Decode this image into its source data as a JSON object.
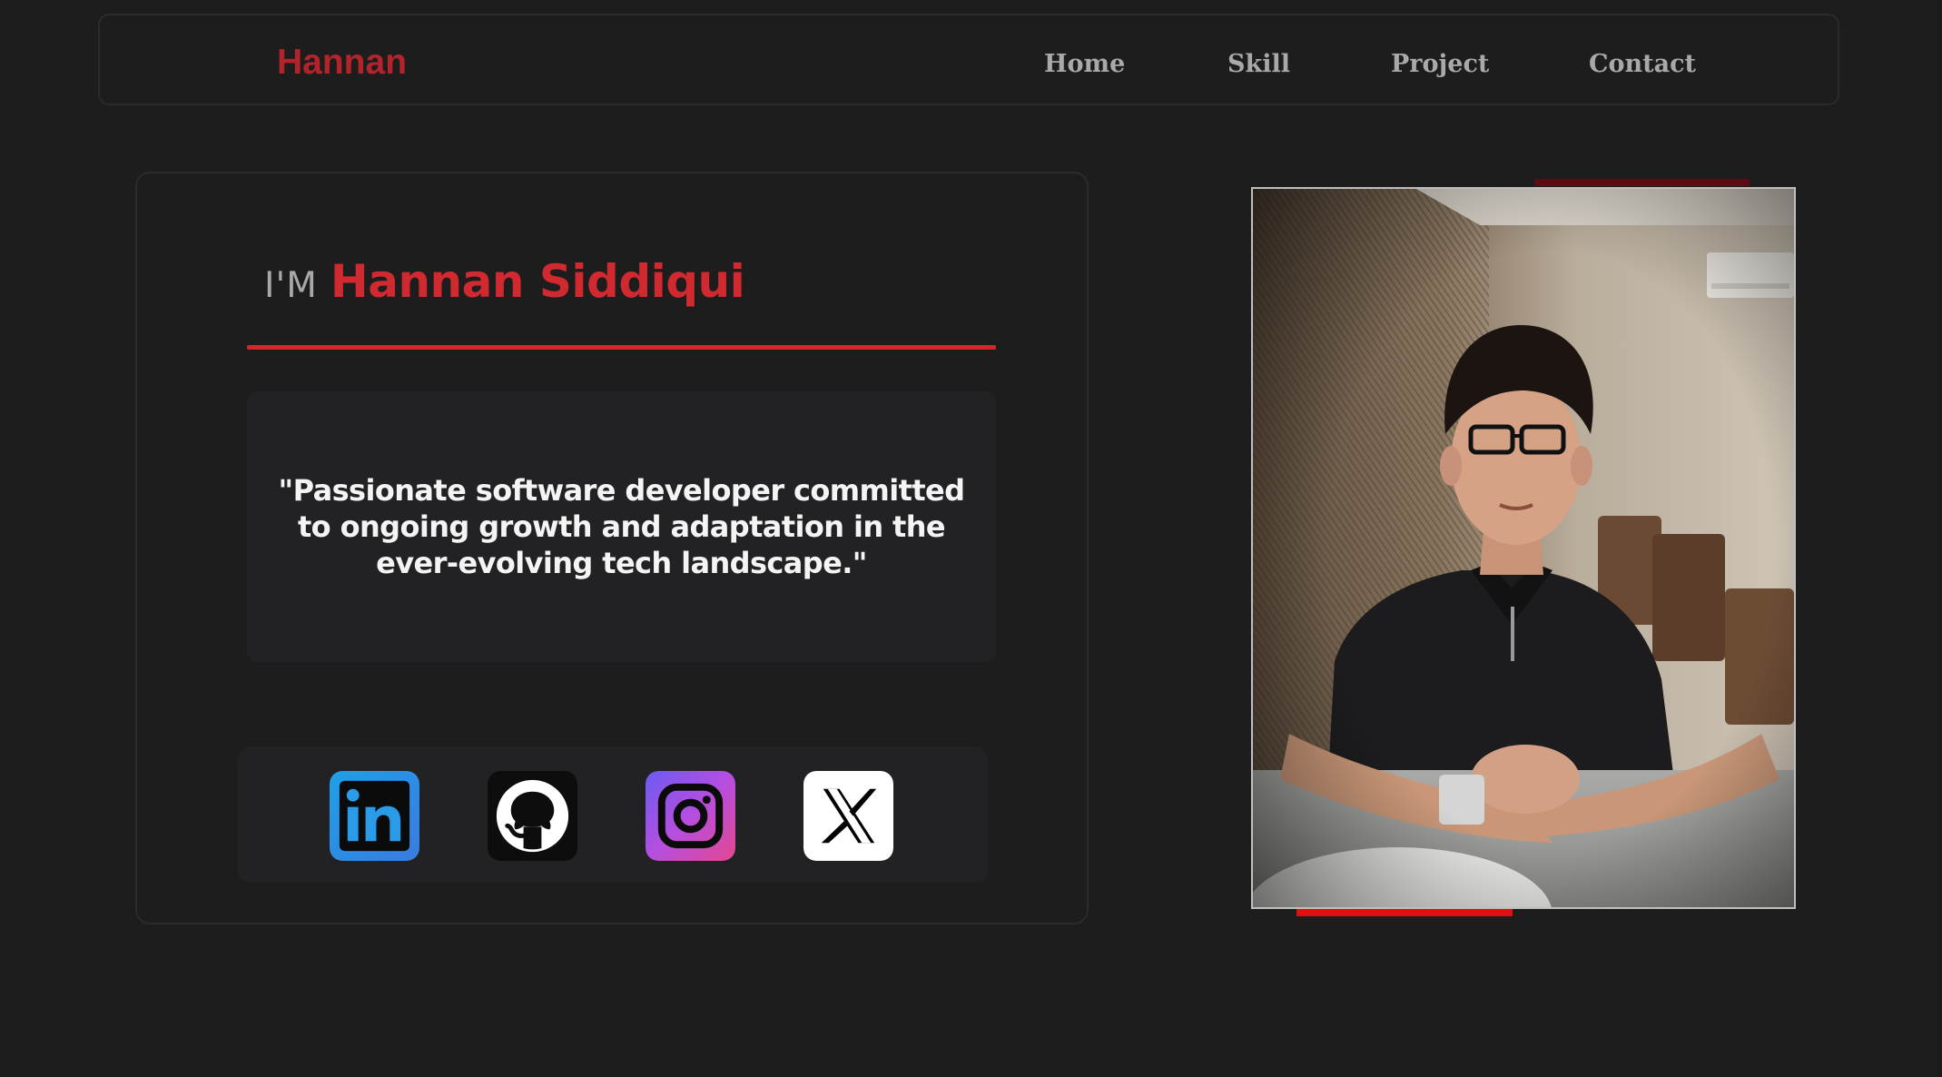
{
  "nav": {
    "brand": "Hannan",
    "links": [
      "Home",
      "Skill",
      "Project",
      "Contact"
    ]
  },
  "hero": {
    "prefix": "I'M",
    "name": "Hannan Siddiqui",
    "quote": "\"Passionate software developer committed to ongoing growth and adaptation in the ever-evolving tech landscape.\""
  },
  "social": [
    {
      "name": "LinkedIn",
      "icon": "linkedin-icon"
    },
    {
      "name": "GitHub",
      "icon": "github-icon"
    },
    {
      "name": "Instagram",
      "icon": "instagram-icon"
    },
    {
      "name": "X",
      "icon": "x-icon"
    }
  ],
  "colors": {
    "background": "#1d1d1e",
    "accent_red": "#d02a30",
    "brand_red": "#b3232a",
    "nav_text": "#a9a9a9",
    "card_border": "#2b2b2d"
  }
}
